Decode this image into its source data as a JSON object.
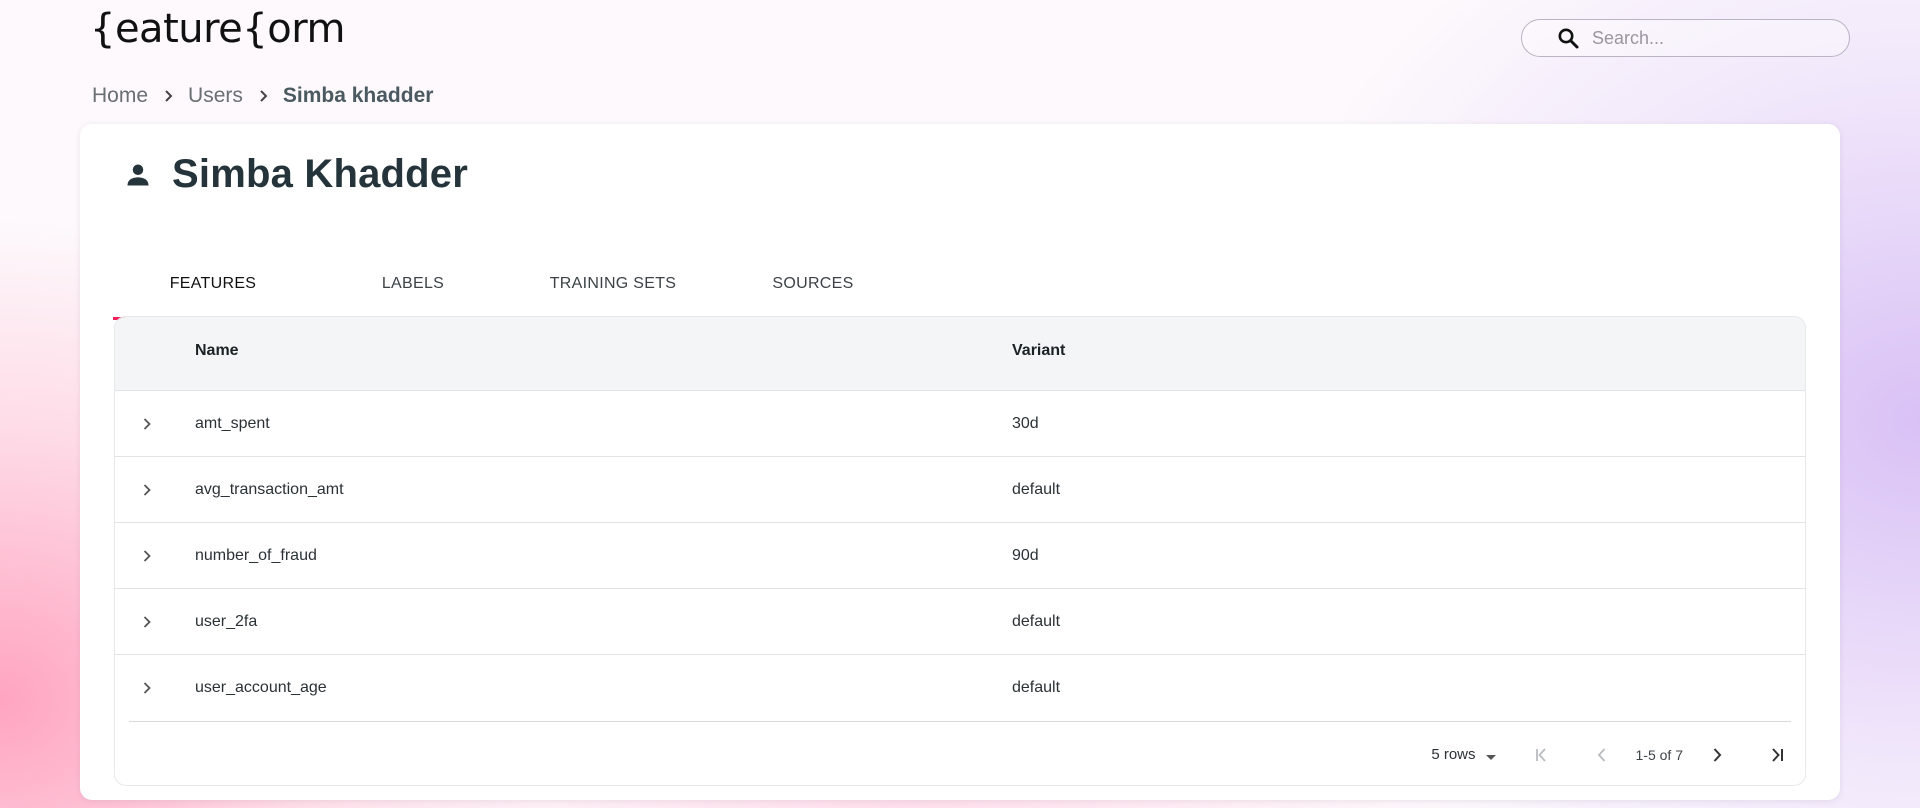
{
  "logo": {
    "text": "{eature{orm"
  },
  "search": {
    "placeholder": "Search..."
  },
  "breadcrumb": {
    "items": [
      {
        "label": "Home"
      },
      {
        "label": "Users"
      },
      {
        "label": "Simba khadder"
      }
    ]
  },
  "page": {
    "title": "Simba Khadder",
    "icon": "person-icon"
  },
  "tabs": [
    {
      "label": "FEATURES",
      "active": true
    },
    {
      "label": "LABELS",
      "active": false
    },
    {
      "label": "TRAINING SETS",
      "active": false
    },
    {
      "label": "SOURCES",
      "active": false
    }
  ],
  "table": {
    "columns": {
      "name": "Name",
      "variant": "Variant"
    },
    "rows": [
      {
        "name": "amt_spent",
        "variant": "30d"
      },
      {
        "name": "avg_transaction_amt",
        "variant": "default"
      },
      {
        "name": "number_of_fraud",
        "variant": "90d"
      },
      {
        "name": "user_2fa",
        "variant": "default"
      },
      {
        "name": "user_account_age",
        "variant": "default"
      }
    ]
  },
  "pagination": {
    "rows_per_page": "5 rows",
    "page_info": "1-5 of 7"
  },
  "colors": {
    "accent": "#f0205a",
    "title": "#24343a",
    "header_bg": "#f4f5f6"
  }
}
